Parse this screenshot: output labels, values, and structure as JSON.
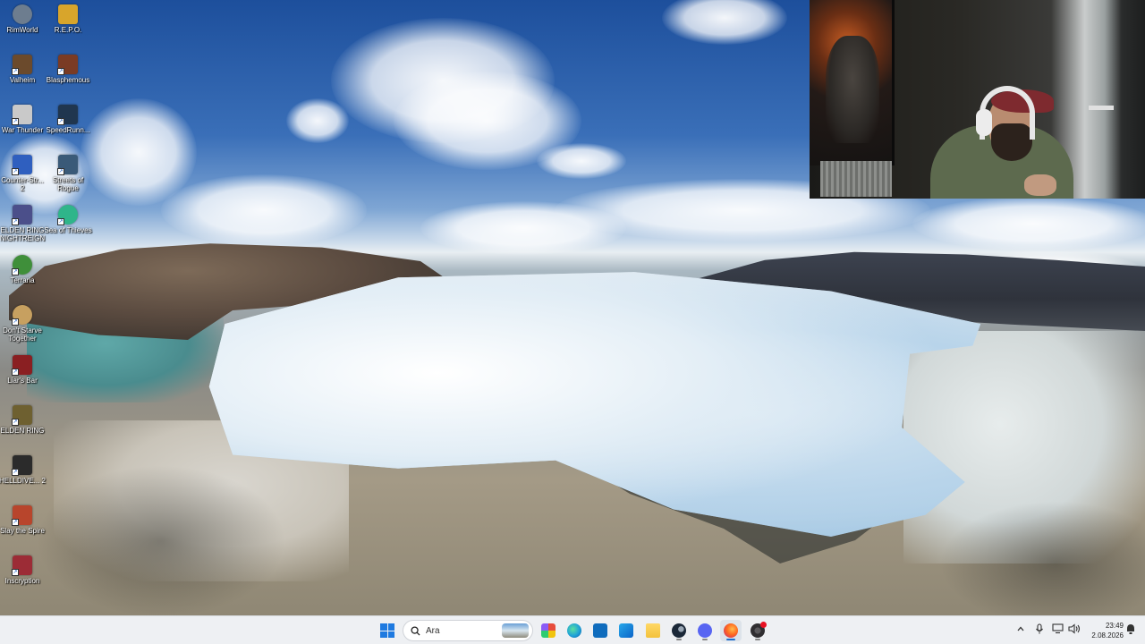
{
  "desktop": {
    "icons": [
      {
        "label": "RimWorld",
        "icon": "rimworld-icon",
        "color": "#6d7d8f"
      },
      {
        "label": "R.E.P.O.",
        "icon": "repo-icon",
        "color": "#d8a52b"
      },
      {
        "label": "Valheim",
        "icon": "valheim-icon",
        "color": "#6b4a2c"
      },
      {
        "label": "Blasphemous",
        "icon": "blasphemous-icon",
        "color": "#7a3b24"
      },
      {
        "label": "War Thunder",
        "icon": "war-thunder-icon",
        "color": "#c9c9c9"
      },
      {
        "label": "SpeedRunn...",
        "icon": "speedrunners-icon",
        "color": "#20364f"
      },
      {
        "label": "Counter-Str... 2",
        "icon": "counter-strike-icon",
        "color": "#2f5fbf"
      },
      {
        "label": "Streets of Rogue",
        "icon": "streets-of-rogue-icon",
        "color": "#3a5a78"
      },
      {
        "label": "ELDEN RING NIGHTREIGN",
        "icon": "elden-ring-nightreign-icon",
        "color": "#4b4f8a"
      },
      {
        "label": "Sea of Thieves",
        "icon": "sea-of-thieves-icon",
        "color": "#2fb58a"
      },
      {
        "label": "Terraria",
        "icon": "terraria-icon",
        "color": "#3f8f3a"
      },
      {
        "label": "Don't Starve Together",
        "icon": "dont-starve-icon",
        "color": "#c7a060"
      },
      {
        "label": "Liar's Bar",
        "icon": "liars-bar-icon",
        "color": "#8a1f22"
      },
      {
        "label": "ELDEN RING",
        "icon": "elden-ring-icon",
        "color": "#6e6030"
      },
      {
        "label": "HELLDIVE... 2",
        "icon": "helldivers-icon",
        "color": "#2b2b2b"
      },
      {
        "label": "Slay the Spire",
        "icon": "slay-the-spire-icon",
        "color": "#b8452c"
      },
      {
        "label": "Inscryption",
        "icon": "inscryption-icon",
        "color": "#9c2c36"
      }
    ]
  },
  "webcam": {
    "label": "webcam-overlay"
  },
  "taskbar": {
    "search_placeholder": "Ara",
    "apps": [
      {
        "name": "widgets",
        "icon": "color-app-icon",
        "color": "#8b5cf6"
      },
      {
        "name": "edge",
        "icon": "edge-icon",
        "color": "#1fa2d8"
      },
      {
        "name": "store",
        "icon": "store-icon",
        "color": "#0f6cbd"
      },
      {
        "name": "outlook",
        "icon": "outlook-icon",
        "color": "#0a64c8"
      },
      {
        "name": "explorer",
        "icon": "folder-icon",
        "color": "#f3c23c"
      },
      {
        "name": "steam",
        "icon": "steam-icon",
        "color": "#1b2838"
      },
      {
        "name": "discord",
        "icon": "discord-icon",
        "color": "#5865f2"
      },
      {
        "name": "firefox",
        "icon": "firefox-icon",
        "color": "#ff6a1f"
      },
      {
        "name": "obs",
        "icon": "obs-icon",
        "color": "#302e31"
      }
    ],
    "time": "23:49",
    "date": "2.08.2026"
  }
}
